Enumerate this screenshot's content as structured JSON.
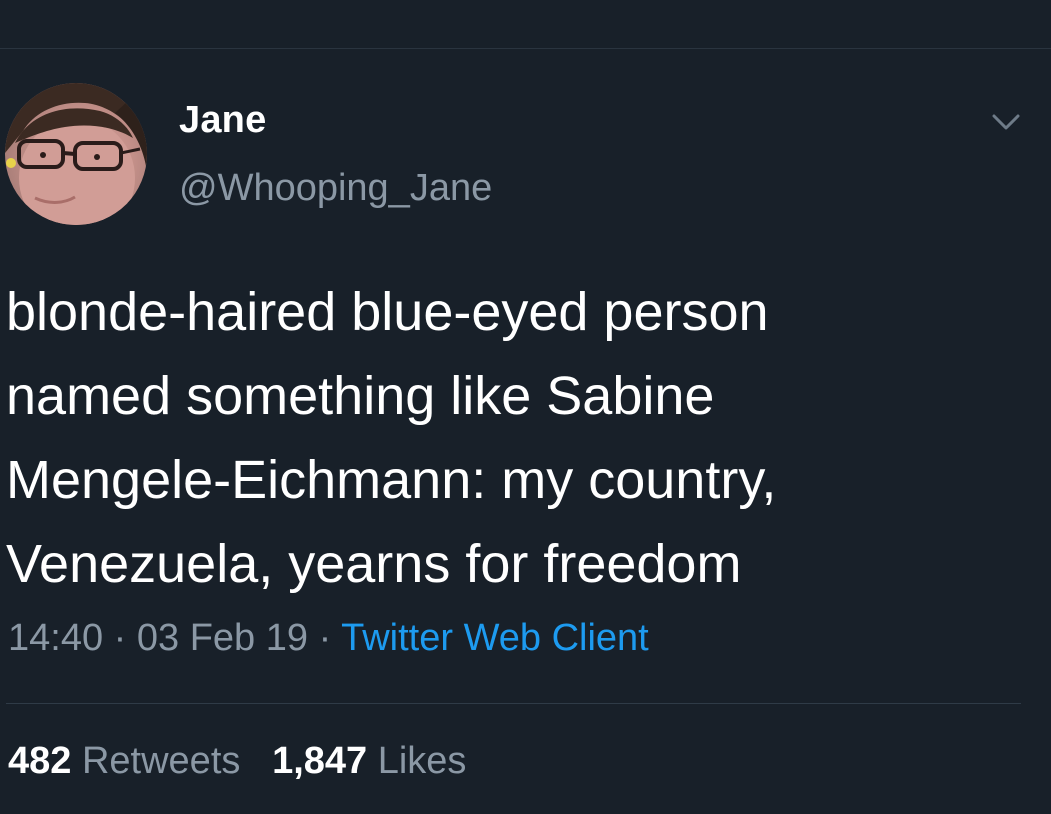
{
  "tweet": {
    "author": {
      "display_name": "Jane",
      "handle": "@Whooping_Jane",
      "avatar_icon": "profile-photo"
    },
    "menu_icon": "chevron-down-icon",
    "text_lines": [
      "blonde-haired blue-eyed person",
      "named something like Sabine",
      "Mengele-Eichmann: my country,",
      "Venezuela, yearns for freedom"
    ],
    "meta": {
      "time": "14:40",
      "separator": "·",
      "date": "03 Feb 19",
      "source": "Twitter Web Client"
    },
    "stats": {
      "retweets_count": "482",
      "retweets_label": "Retweets",
      "likes_count": "1,847",
      "likes_label": "Likes"
    }
  },
  "colors": {
    "background": "#182029",
    "primary_text": "#ffffff",
    "secondary_text": "#8b98a5",
    "link": "#1d9bf0",
    "divider": "#2f3b47"
  }
}
